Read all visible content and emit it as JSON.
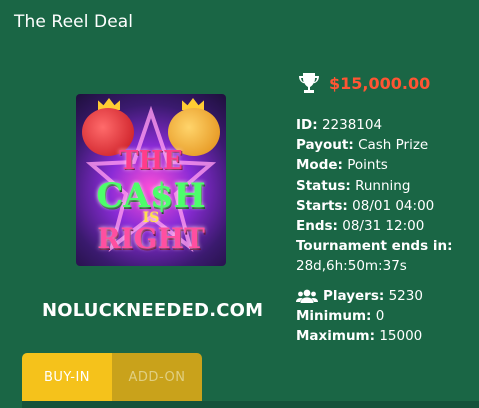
{
  "tournament": {
    "title": "The Reel Deal",
    "prize": "$15,000.00",
    "prize_icon": "trophy-icon",
    "game_art": {
      "line1": "THE",
      "line2": "CA$H",
      "line3": "IS",
      "line4": "RIGHT"
    },
    "watermark": "NOLUCKNEEDED.COM",
    "details": [
      {
        "label": "ID:",
        "value": "2238104"
      },
      {
        "label": "Payout:",
        "value": "Cash Prize"
      },
      {
        "label": "Mode:",
        "value": "Points"
      },
      {
        "label": "Status:",
        "value": "Running"
      },
      {
        "label": "Starts:",
        "value": "08/01 04:00"
      },
      {
        "label": "Ends:",
        "value": "08/31 12:00"
      },
      {
        "label": "Tournament ends in:",
        "value": "28d,6h:50m:37s"
      }
    ],
    "limits": {
      "players_label": "Players:",
      "players_value": "5230",
      "players_icon": "users-icon",
      "minimum_label": "Minimum:",
      "minimum_value": "0",
      "maximum_label": "Maximum:",
      "maximum_value": "15000"
    }
  },
  "tabs": [
    {
      "label": "BUY-IN",
      "active": true
    },
    {
      "label": "ADD-ON",
      "active": false
    }
  ],
  "colors": {
    "background": "#1a6645",
    "prize": "#ff5533",
    "tab_active": "#f5c21b",
    "tab_inactive": "#c9a21b"
  }
}
